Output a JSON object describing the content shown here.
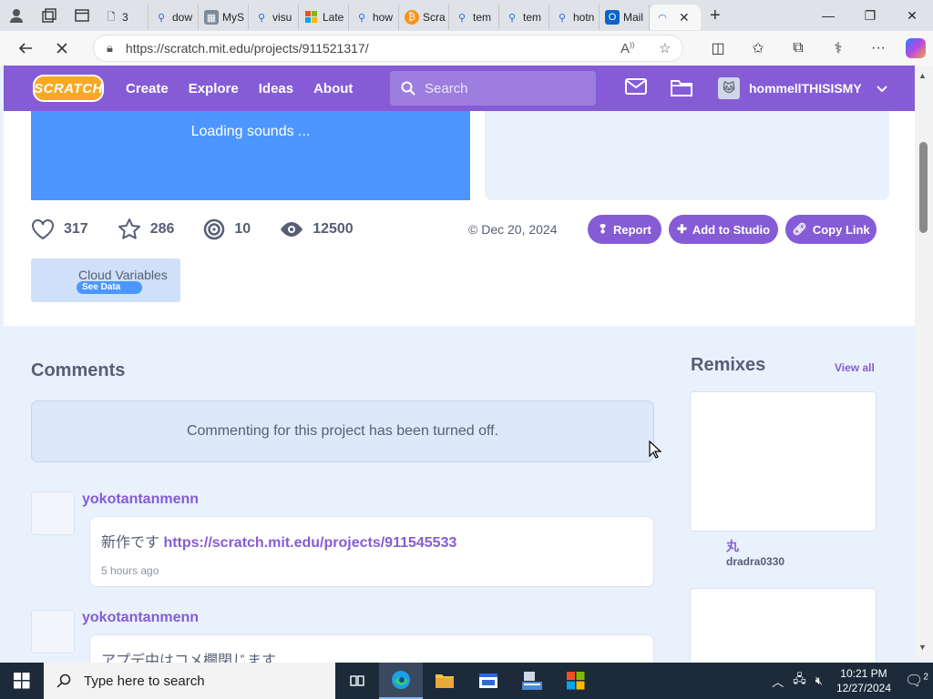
{
  "browser": {
    "tabs": [
      {
        "label": "3",
        "icon": "page-icon"
      },
      {
        "label": "dow",
        "icon": "search-icon"
      },
      {
        "label": "MyS",
        "icon": "image-icon"
      },
      {
        "label": "visu",
        "icon": "search-icon"
      },
      {
        "label": "Late",
        "icon": "windows-icon"
      },
      {
        "label": "how",
        "icon": "search-icon"
      },
      {
        "label": "Scra",
        "icon": "bitcoin-icon"
      },
      {
        "label": "tem",
        "icon": "search-icon"
      },
      {
        "label": "tem",
        "icon": "search-icon"
      },
      {
        "label": "hotn",
        "icon": "search-icon"
      },
      {
        "label": "Mail",
        "icon": "outlook-icon"
      }
    ],
    "url": "https://scratch.mit.edu/projects/911521317/"
  },
  "scratch_nav": {
    "logo": "SCRATCH",
    "links": [
      "Create",
      "Explore",
      "Ideas",
      "About"
    ],
    "search_placeholder": "Search",
    "username": "hommellTHISISMY"
  },
  "project": {
    "loading_text": "Loading sounds ...",
    "loves": "317",
    "favorites": "286",
    "remixes": "10",
    "views": "12500",
    "date": "© Dec 20, 2024",
    "report_label": "Report",
    "add_to_studio_label": "Add to Studio",
    "copy_link_label": "Copy Link",
    "cloud_variables": "Cloud Variables",
    "see_data": "See Data"
  },
  "comments": {
    "title": "Comments",
    "disabled_notice": "Commenting for this project has been turned off.",
    "items": [
      {
        "user": "yokotantanmenn",
        "text_prefix": "新作です ",
        "link": "https://scratch.mit.edu/projects/911545533",
        "time": "5 hours ago"
      },
      {
        "user": "yokotantanmenn",
        "text_prefix": "アプデ中はコメ欄閉じます",
        "link": "",
        "time": ""
      }
    ]
  },
  "remixes": {
    "title": "Remixes",
    "view_all": "View all",
    "items": [
      {
        "name": "丸",
        "owner": "dradra0330"
      }
    ]
  },
  "taskbar": {
    "search_placeholder": "Type here to search",
    "time": "10:21 PM",
    "date": "12/27/2024",
    "notification_count": "2"
  },
  "colors": {
    "scratch_purple": "#855cd6",
    "stage_blue": "#4c97ff",
    "page_bg": "#e9f1fc",
    "text_gray": "#575e75"
  }
}
